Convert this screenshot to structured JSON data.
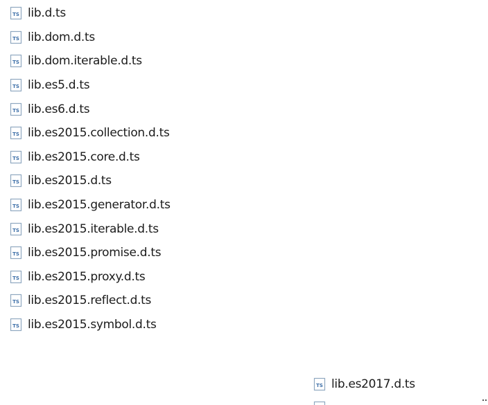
{
  "icon": "typescript-file-icon",
  "icon_text": "TS",
  "colors": {
    "icon_border": "#8fa8c0",
    "icon_text": "#3d6fa8",
    "label": "#1b1b1b"
  },
  "files": [
    {
      "name": "lib.d.ts"
    },
    {
      "name": "lib.dom.d.ts"
    },
    {
      "name": "lib.dom.iterable.d.ts"
    },
    {
      "name": "lib.es5.d.ts"
    },
    {
      "name": "lib.es6.d.ts"
    },
    {
      "name": "lib.es2015.collection.d.ts"
    },
    {
      "name": "lib.es2015.core.d.ts"
    },
    {
      "name": "lib.es2015.d.ts"
    },
    {
      "name": "lib.es2015.generator.d.ts"
    },
    {
      "name": "lib.es2015.iterable.d.ts"
    },
    {
      "name": "lib.es2015.promise.d.ts"
    },
    {
      "name": "lib.es2015.proxy.d.ts"
    },
    {
      "name": "lib.es2015.reflect.d.ts"
    },
    {
      "name": "lib.es2015.symbol.d.ts"
    }
  ],
  "second_column": [
    {
      "name": "lib.es2017.d.ts"
    }
  ]
}
